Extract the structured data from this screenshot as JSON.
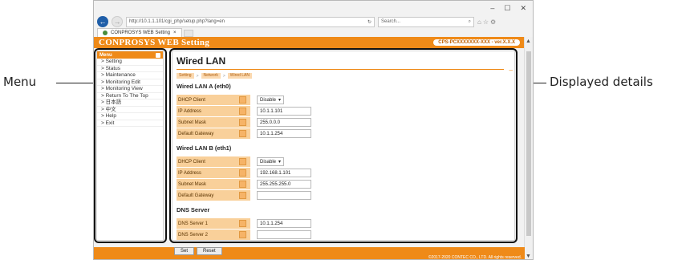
{
  "callouts": {
    "left": "Menu",
    "right": "Displayed details"
  },
  "browser": {
    "window_controls": {
      "minimize": "–",
      "maximize": "☐",
      "close": "✕"
    },
    "url": "http://10.1.1.101/cgi_php/setup.php?lang=en",
    "refresh": "↻",
    "search_placeholder": "Search...",
    "search_icon": "⌕",
    "tab_title": "CONPROSYS WEB Setting",
    "tab_close": "×"
  },
  "app": {
    "title": "CONPROSYS WEB Setting",
    "model": "CPS-PCXXXXXXX-XXX - ver.X.X.X"
  },
  "menu": {
    "header": "Menu",
    "items": [
      "> Setting",
      "> Status",
      "> Maintenance",
      "> Monitoring Edit",
      "> Monitoring View",
      "> Return To The Top",
      "> 日本語",
      "> 中文",
      "> Help",
      "> Exit"
    ]
  },
  "content": {
    "title": "Wired LAN",
    "breadcrumbs": [
      "Setting",
      "Network",
      "Wired LAN"
    ],
    "sections": {
      "eth0": {
        "title": "Wired LAN A (eth0)",
        "dhcp_label": "DHCP Client",
        "dhcp_value": "Disable",
        "ip_label": "IP Address",
        "ip_value": "10.1.1.101",
        "mask_label": "Subnet Mask",
        "mask_value": "255.0.0.0",
        "gw_label": "Default Gateway",
        "gw_value": "10.1.1.254"
      },
      "eth1": {
        "title": "Wired LAN B (eth1)",
        "dhcp_label": "DHCP Client",
        "dhcp_value": "Disable",
        "ip_label": "IP Address",
        "ip_value": "192.168.1.101",
        "mask_label": "Subnet Mask",
        "mask_value": "255.255.255.0",
        "gw_label": "Default Gateway",
        "gw_value": ""
      },
      "dns": {
        "title": "DNS Server",
        "dns1_label": "DNS Server 1",
        "dns1_value": "10.1.1.254",
        "dns2_label": "DNS Server 2",
        "dns2_value": ""
      }
    }
  },
  "footer": {
    "set_button": "Set",
    "reset_button": "Reset",
    "copyright": "©2017-2020 CONTEC CO., LTD. All rights reserved."
  },
  "colors": {
    "accent": "#ef8a18",
    "label_bg": "#f9d09a",
    "highlight": "#111111"
  }
}
